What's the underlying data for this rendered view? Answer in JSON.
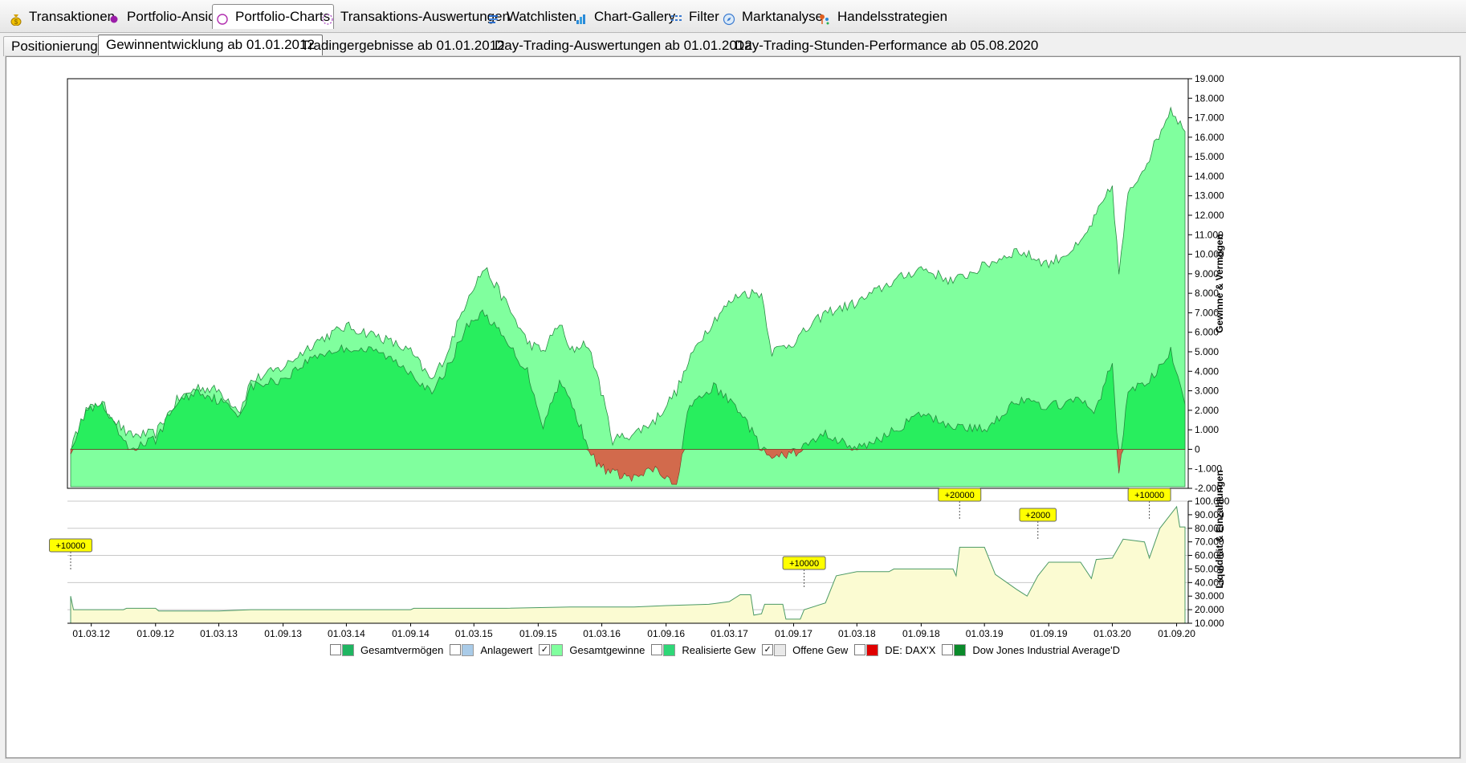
{
  "main_tabs": [
    {
      "label": "Transaktionen",
      "icon": "money-bag-icon",
      "active": false
    },
    {
      "label": "Portfolio-Ansicht",
      "icon": "purple-dot-icon",
      "active": false
    },
    {
      "label": "Portfolio-Charts",
      "icon": "dotted-circle-icon",
      "active": true
    },
    {
      "label": "Transaktions-Auswertungen",
      "icon": "dashed-circle-icon",
      "active": false
    },
    {
      "label": "Watchlisten",
      "icon": "list-icon",
      "active": false
    },
    {
      "label": "Chart-Gallery",
      "icon": "bar-chart-icon",
      "active": false
    },
    {
      "label": "Filter",
      "icon": "filter-grid-icon",
      "active": false
    },
    {
      "label": "Marktanalyse",
      "icon": "compass-icon",
      "active": false
    },
    {
      "label": "Handelsstrategien",
      "icon": "strategy-pins-icon",
      "active": false
    }
  ],
  "sub_tabs": [
    {
      "label": "Positionierung",
      "active": false
    },
    {
      "label": "Gewinnentwicklung ab 01.01.2012",
      "active": true
    },
    {
      "label": "Tradingergebnisse ab 01.01.2012",
      "active": false
    },
    {
      "label": "Day-Trading-Auswertungen ab 01.01.2012",
      "active": false
    },
    {
      "label": "Day-Trading-Stunden-Performance ab 05.08.2020",
      "active": false
    }
  ],
  "colors": {
    "gesamtgewinne": "#80ff9e",
    "realisierte": "#28ee5e",
    "negative": "#d26a4c",
    "liquiditaet": "#fbfbd2",
    "liquiditaet_line": "#4c9a66",
    "marker_bg": "#ffff00"
  },
  "chart_data": [
    {
      "type": "area",
      "ylabel": "Gewinne & Vermögen",
      "ylim": [
        -2000,
        19000
      ],
      "y_ticks": [
        "19.000",
        "18.000",
        "17.000",
        "16.000",
        "15.000",
        "14.000",
        "13.000",
        "12.000",
        "11.000",
        "10.000",
        "9.000",
        "8.000",
        "7.000",
        "6.000",
        "5.000",
        "4.000",
        "3.000",
        "2.000",
        "1.000",
        "0",
        "-1.000",
        "-2.000"
      ],
      "x_range": [
        "2012-01-02",
        "2020-09-25"
      ],
      "series": [
        {
          "name": "Gesamtgewinne",
          "values_by_date": [
            [
              "2012-01-02",
              0
            ],
            [
              "2012-02-15",
              2000
            ],
            [
              "2012-04-01",
              2300
            ],
            [
              "2012-06-15",
              700
            ],
            [
              "2012-09-01",
              800
            ],
            [
              "2012-11-01",
              2500
            ],
            [
              "2013-01-01",
              3200
            ],
            [
              "2013-03-01",
              3000
            ],
            [
              "2013-05-01",
              2000
            ],
            [
              "2013-06-01",
              3500
            ],
            [
              "2013-09-01",
              4200
            ],
            [
              "2013-12-01",
              5500
            ],
            [
              "2014-03-01",
              6300
            ],
            [
              "2014-06-01",
              5800
            ],
            [
              "2014-09-01",
              5000
            ],
            [
              "2014-11-01",
              3500
            ],
            [
              "2014-12-15",
              5000
            ],
            [
              "2015-02-15",
              8000
            ],
            [
              "2015-04-01",
              9300
            ],
            [
              "2015-06-01",
              7500
            ],
            [
              "2015-08-01",
              5500
            ],
            [
              "2015-09-15",
              5000
            ],
            [
              "2015-11-01",
              6500
            ],
            [
              "2015-12-01",
              5000
            ],
            [
              "2016-01-15",
              5500
            ],
            [
              "2016-02-15",
              4000
            ],
            [
              "2016-04-01",
              500
            ],
            [
              "2016-06-01",
              800
            ],
            [
              "2016-08-01",
              1500
            ],
            [
              "2016-10-01",
              3000
            ],
            [
              "2016-12-01",
              5500
            ],
            [
              "2017-02-01",
              7000
            ],
            [
              "2017-04-01",
              8000
            ],
            [
              "2017-06-01",
              8000
            ],
            [
              "2017-07-01",
              5000
            ],
            [
              "2017-09-01",
              5500
            ],
            [
              "2017-12-01",
              7000
            ],
            [
              "2018-03-01",
              7500
            ],
            [
              "2018-06-01",
              8500
            ],
            [
              "2018-09-01",
              9300
            ],
            [
              "2018-12-01",
              8600
            ],
            [
              "2019-03-01",
              9400
            ],
            [
              "2019-06-01",
              10200
            ],
            [
              "2019-09-01",
              9500
            ],
            [
              "2019-12-01",
              10500
            ],
            [
              "2020-01-15",
              12000
            ],
            [
              "2020-03-01",
              13500
            ],
            [
              "2020-03-20",
              9000
            ],
            [
              "2020-04-15",
              13000
            ],
            [
              "2020-06-15",
              15000
            ],
            [
              "2020-08-15",
              17500
            ],
            [
              "2020-09-25",
              16300
            ]
          ]
        },
        {
          "name": "Realisierte Gew",
          "values_by_date": [
            [
              "2012-01-02",
              0
            ],
            [
              "2012-02-15",
              2000
            ],
            [
              "2012-04-01",
              2200
            ],
            [
              "2012-06-15",
              0
            ],
            [
              "2012-09-01",
              500
            ],
            [
              "2012-11-01",
              2400
            ],
            [
              "2013-01-01",
              3000
            ],
            [
              "2013-03-01",
              2500
            ],
            [
              "2013-05-01",
              1800
            ],
            [
              "2013-06-01",
              3200
            ],
            [
              "2013-09-01",
              3600
            ],
            [
              "2013-12-01",
              4800
            ],
            [
              "2014-03-01",
              5200
            ],
            [
              "2014-06-01",
              5000
            ],
            [
              "2014-09-01",
              4000
            ],
            [
              "2014-11-01",
              2800
            ],
            [
              "2014-12-15",
              4200
            ],
            [
              "2015-02-15",
              6500
            ],
            [
              "2015-04-01",
              7000
            ],
            [
              "2015-06-01",
              5500
            ],
            [
              "2015-08-01",
              4000
            ],
            [
              "2015-09-15",
              1200
            ],
            [
              "2015-11-01",
              3500
            ],
            [
              "2015-12-01",
              2500
            ],
            [
              "2016-01-15",
              500
            ],
            [
              "2016-02-15",
              -800
            ],
            [
              "2016-04-01",
              -1200
            ],
            [
              "2016-06-01",
              -1500
            ],
            [
              "2016-08-01",
              -1000
            ],
            [
              "2016-10-01",
              -2000
            ],
            [
              "2016-11-01",
              2000
            ],
            [
              "2017-01-15",
              3200
            ],
            [
              "2017-04-01",
              2000
            ],
            [
              "2017-06-01",
              0
            ],
            [
              "2017-07-01",
              -500
            ],
            [
              "2017-09-01",
              -200
            ],
            [
              "2017-12-01",
              800
            ],
            [
              "2018-03-01",
              0
            ],
            [
              "2018-06-01",
              800
            ],
            [
              "2018-09-01",
              1800
            ],
            [
              "2018-12-01",
              1200
            ],
            [
              "2019-03-01",
              1000
            ],
            [
              "2019-06-01",
              2500
            ],
            [
              "2019-09-01",
              2200
            ],
            [
              "2019-12-01",
              2500
            ],
            [
              "2020-01-15",
              2000
            ],
            [
              "2020-03-01",
              4500
            ],
            [
              "2020-03-20",
              -1200
            ],
            [
              "2020-04-15",
              3000
            ],
            [
              "2020-06-15",
              3500
            ],
            [
              "2020-08-15",
              5000
            ],
            [
              "2020-09-25",
              2300
            ]
          ]
        }
      ]
    },
    {
      "type": "area",
      "ylabel": "Liquidität & Einzahlungen",
      "ylim": [
        10000,
        100000
      ],
      "y_ticks": [
        "100.000",
        "90.000",
        "80.000",
        "70.000",
        "60.000",
        "50.000",
        "40.000",
        "30.000",
        "20.000",
        "10.000"
      ],
      "x_ticks": [
        "01.03.12",
        "01.09.12",
        "01.03.13",
        "01.09.13",
        "01.03.14",
        "01.09.14",
        "01.03.15",
        "01.09.15",
        "01.03.16",
        "01.09.16",
        "01.03.17",
        "01.09.17",
        "01.03.18",
        "01.09.18",
        "01.03.19",
        "01.09.19",
        "01.03.20",
        "01.09.20"
      ],
      "series": [
        {
          "name": "Liquidität",
          "values_by_date": [
            [
              "2012-01-02",
              30000
            ],
            [
              "2012-01-10",
              20000
            ],
            [
              "2012-06-01",
              20000
            ],
            [
              "2012-06-10",
              21000
            ],
            [
              "2012-09-01",
              21000
            ],
            [
              "2012-09-10",
              19000
            ],
            [
              "2013-03-01",
              19000
            ],
            [
              "2013-06-01",
              20000
            ],
            [
              "2014-09-01",
              20000
            ],
            [
              "2014-09-10",
              21000
            ],
            [
              "2015-06-01",
              21000
            ],
            [
              "2015-12-01",
              22000
            ],
            [
              "2016-06-01",
              22000
            ],
            [
              "2016-09-01",
              23000
            ],
            [
              "2017-01-01",
              24000
            ],
            [
              "2017-03-01",
              26000
            ],
            [
              "2017-04-01",
              31000
            ],
            [
              "2017-05-01",
              31000
            ],
            [
              "2017-05-10",
              16000
            ],
            [
              "2017-06-01",
              17000
            ],
            [
              "2017-06-10",
              24000
            ],
            [
              "2017-08-01",
              24000
            ],
            [
              "2017-08-10",
              13000
            ],
            [
              "2017-09-20",
              13000
            ],
            [
              "2017-10-01",
              20000
            ],
            [
              "2017-12-01",
              25000
            ],
            [
              "2018-01-01",
              45000
            ],
            [
              "2018-03-01",
              48000
            ],
            [
              "2018-06-01",
              48000
            ],
            [
              "2018-06-15",
              50000
            ],
            [
              "2018-12-01",
              50000
            ],
            [
              "2018-12-10",
              45000
            ],
            [
              "2018-12-20",
              66000
            ],
            [
              "2019-03-01",
              66000
            ],
            [
              "2019-04-01",
              46000
            ],
            [
              "2019-06-01",
              35000
            ],
            [
              "2019-07-01",
              30000
            ],
            [
              "2019-08-01",
              45000
            ],
            [
              "2019-09-01",
              55000
            ],
            [
              "2019-12-01",
              55000
            ],
            [
              "2020-01-01",
              43000
            ],
            [
              "2020-01-15",
              57000
            ],
            [
              "2020-03-01",
              58000
            ],
            [
              "2020-04-01",
              72000
            ],
            [
              "2020-06-01",
              70000
            ],
            [
              "2020-06-15",
              58000
            ],
            [
              "2020-07-15",
              80000
            ],
            [
              "2020-09-01",
              96000
            ],
            [
              "2020-09-10",
              81000
            ],
            [
              "2020-09-25",
              81000
            ]
          ]
        }
      ],
      "annotations": [
        {
          "label": "+10000",
          "date": "2012-01-02"
        },
        {
          "label": "+10000",
          "date": "2017-10-01"
        },
        {
          "label": "+20000",
          "date": "2018-12-20"
        },
        {
          "label": "+2000",
          "date": "2019-08-01"
        },
        {
          "label": "+10000",
          "date": "2020-06-15"
        }
      ]
    }
  ],
  "legend": [
    {
      "label": "Gesamtvermögen",
      "checked": false,
      "color": "#1fb561"
    },
    {
      "label": "Anlagewert",
      "checked": false,
      "color": "#a9cbe8"
    },
    {
      "label": "Gesamtgewinne",
      "checked": true,
      "color": "#80ff9e"
    },
    {
      "label": "Realisierte Gew",
      "checked": false,
      "color": "#2ed777"
    },
    {
      "label": "Offene Gew",
      "checked": true,
      "color": "#e9e9e9"
    },
    {
      "label": "DE: DAX'X",
      "checked": false,
      "color": "#e00000"
    },
    {
      "label": "Dow Jones Industrial Average'D",
      "checked": false,
      "color": "#0a8a2a"
    }
  ]
}
